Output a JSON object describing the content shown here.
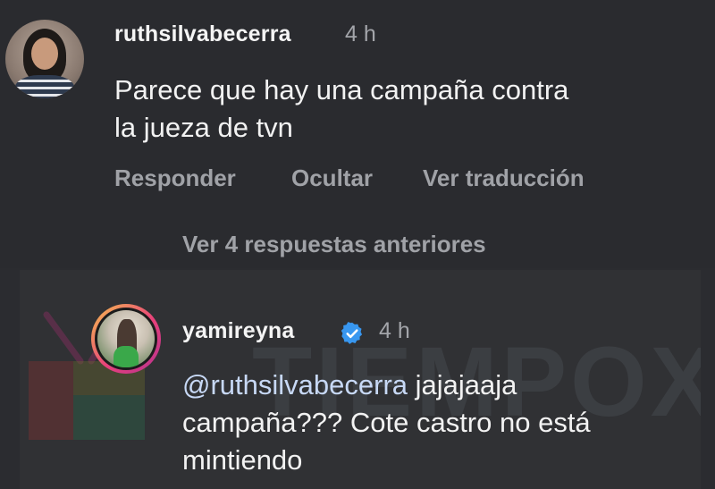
{
  "comment": {
    "username": "ruthsilvabecerra",
    "time": "4 h",
    "text_line1": "Parece que hay una campaña contra",
    "text_line2": "la jueza de tvn",
    "actions": {
      "reply": "Responder",
      "hide": "Ocultar",
      "translate": "Ver traducción"
    },
    "view_replies": "Ver 4 respuestas anteriores"
  },
  "reply": {
    "username": "yamireyna",
    "time": "4 h",
    "mention": "@ruthsilvabecerra",
    "text_line1_rest": " jajajaaja",
    "text_line2": "campaña??? Cote castro no está",
    "text_line3": "mintiendo"
  },
  "watermark": {
    "text": "TIEMPOX"
  },
  "colors": {
    "background": "#2b2c30",
    "reply_background": "#303134",
    "secondary_text": "#a0a2a7",
    "verified_badge": "#3897f0"
  }
}
